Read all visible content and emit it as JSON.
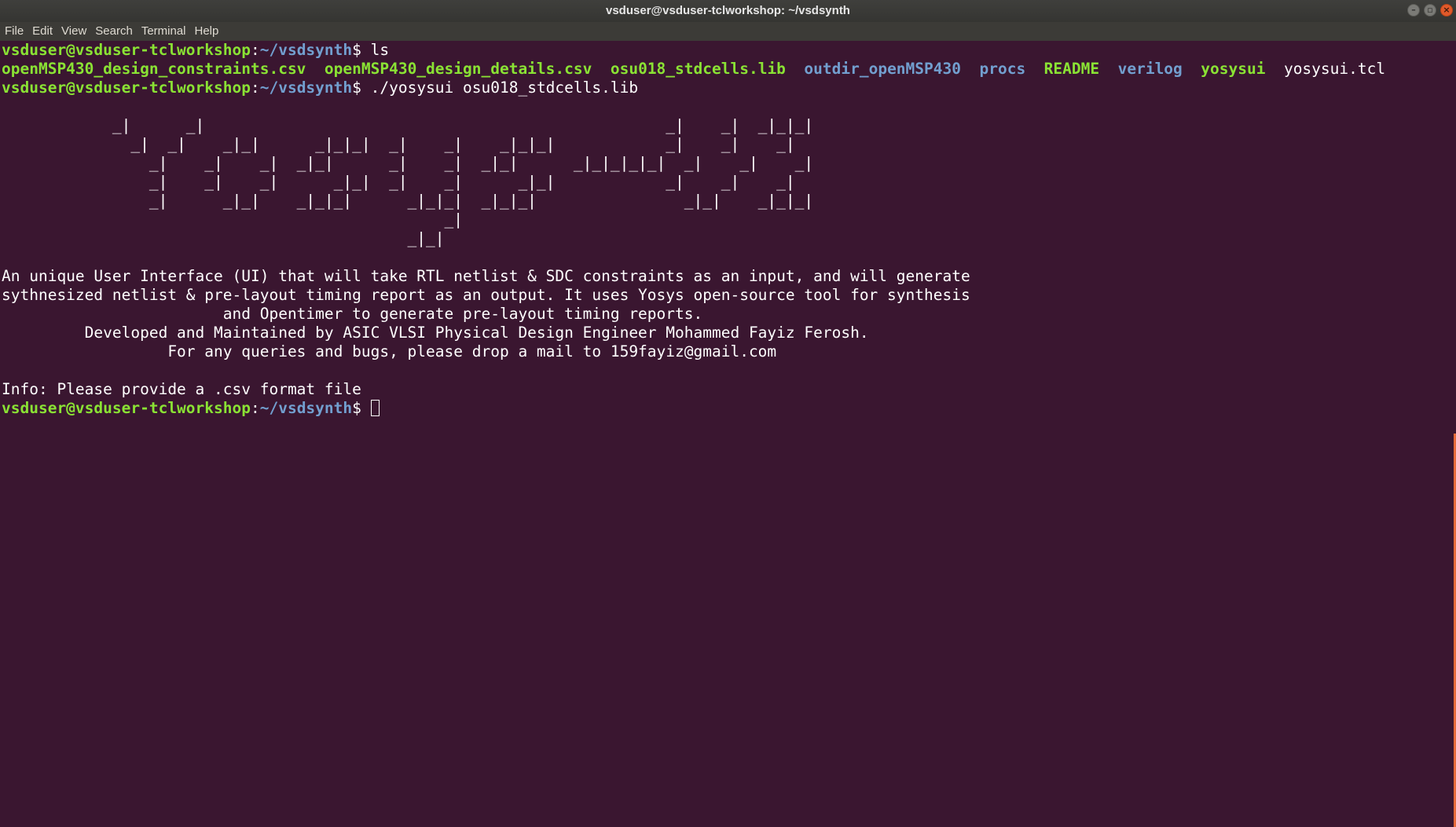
{
  "window": {
    "title": "vsduser@vsduser-tclworkshop: ~/vsdsynth",
    "buttons": {
      "minimize": "–",
      "maximize": "▫",
      "close": "×"
    }
  },
  "menubar": {
    "items": [
      "File",
      "Edit",
      "View",
      "Search",
      "Terminal",
      "Help"
    ]
  },
  "terminal": {
    "prompt_user": "vsduser@vsduser-tclworkshop",
    "prompt_sep": ":",
    "prompt_path": "~/vsdsynth",
    "prompt_dollar": "$ ",
    "cmd1": "ls",
    "ls_entries": [
      {
        "name": "openMSP430_design_constraints.csv",
        "kind": "exec"
      },
      {
        "name": "openMSP430_design_details.csv",
        "kind": "exec"
      },
      {
        "name": "osu018_stdcells.lib",
        "kind": "exec"
      },
      {
        "name": "outdir_openMSP430",
        "kind": "dir"
      },
      {
        "name": "procs",
        "kind": "dir"
      },
      {
        "name": "README",
        "kind": "exec"
      },
      {
        "name": "verilog",
        "kind": "dir"
      },
      {
        "name": "yosysui",
        "kind": "exec"
      },
      {
        "name": "yosysui.tcl",
        "kind": "file"
      }
    ],
    "ls_sep": "  ",
    "cmd2": "./yosysui osu018_stdcells.lib",
    "banner": [
      "",
      "            _|      _|                                                  _|    _|  _|_|_|",
      "              _|  _|    _|_|      _|_|_|  _|    _|    _|_|_|            _|    _|    _|",
      "                _|    _|    _|  _|_|      _|    _|  _|_|      _|_|_|_|_|  _|    _|    _|",
      "                _|    _|    _|      _|_|  _|    _|      _|_|            _|    _|    _|",
      "                _|      _|_|    _|_|_|      _|_|_|  _|_|_|                _|_|    _|_|_|",
      "                                                _|",
      "                                            _|_|",
      ""
    ],
    "description": [
      "An unique User Interface (UI) that will take RTL netlist & SDC constraints as an input, and will generate",
      "sythnesized netlist & pre-layout timing report as an output. It uses Yosys open-source tool for synthesis",
      "                        and Opentimer to generate pre-layout timing reports.",
      "         Developed and Maintained by ASIC VLSI Physical Design Engineer Mohammed Fayiz Ferosh.",
      "                  For any queries and bugs, please drop a mail to 159fayiz@gmail.com"
    ],
    "blank": "",
    "info": "Info: Please provide a .csv format file"
  },
  "colors": {
    "background": "#3a1630",
    "prompt_user": "#8ae234",
    "prompt_path": "#729fcf",
    "exec": "#8ae234",
    "dir": "#729fcf",
    "text": "#ffffff",
    "scroll_thumb": "#e56a3a"
  }
}
